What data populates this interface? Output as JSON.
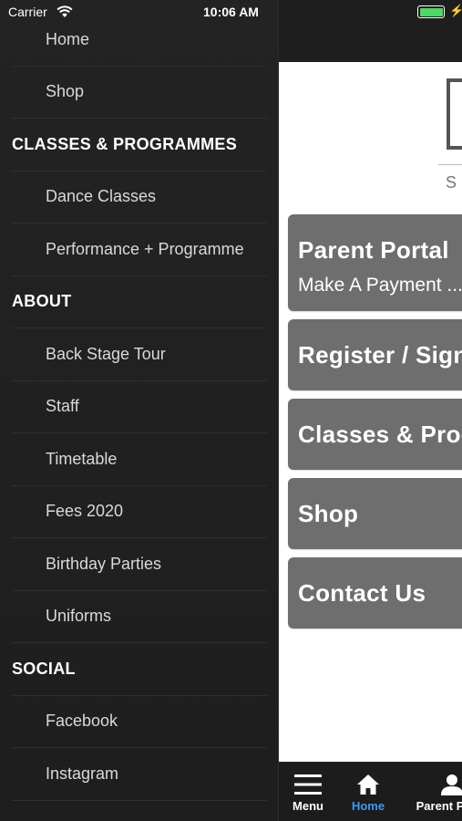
{
  "status_bar": {
    "carrier": "Carrier",
    "time": "10:06 AM"
  },
  "drawer": {
    "rows": [
      {
        "type": "item",
        "label": "Home"
      },
      {
        "type": "item",
        "label": "Shop"
      },
      {
        "type": "header",
        "label": "CLASSES & PROGRAMMES"
      },
      {
        "type": "item",
        "label": "Dance Classes"
      },
      {
        "type": "item",
        "label": "Performance + Programme"
      },
      {
        "type": "header",
        "label": "ABOUT"
      },
      {
        "type": "item",
        "label": "Back Stage Tour"
      },
      {
        "type": "item",
        "label": "Staff"
      },
      {
        "type": "item",
        "label": "Timetable"
      },
      {
        "type": "item",
        "label": "Fees 2020"
      },
      {
        "type": "item",
        "label": "Birthday Parties"
      },
      {
        "type": "item",
        "label": "Uniforms"
      },
      {
        "type": "header",
        "label": "SOCIAL"
      },
      {
        "type": "item",
        "label": "Facebook"
      },
      {
        "type": "item",
        "label": "Instagram"
      }
    ]
  },
  "main": {
    "logo_letter": "S",
    "tiles": [
      {
        "title": "Parent Portal",
        "subtitle": "Make A Payment ..."
      },
      {
        "title": "Register / Sign"
      },
      {
        "title": "Classes & Prog"
      },
      {
        "title": "Shop"
      },
      {
        "title": "Contact Us"
      }
    ]
  },
  "tabbar": {
    "tabs": [
      {
        "label": "Menu",
        "icon": "hamburger-menu-icon",
        "active": false
      },
      {
        "label": "Home",
        "icon": "home-icon",
        "active": true
      },
      {
        "label": "Parent P",
        "icon": "person-icon",
        "active": false
      }
    ]
  },
  "colors": {
    "tab_active": "#3d9bef",
    "tile_bg": "#6e6e6e",
    "drawer_bg": "#232323",
    "battery": "#4cd964"
  }
}
